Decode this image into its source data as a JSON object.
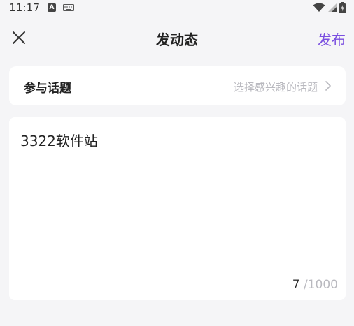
{
  "status_bar": {
    "time": "11:17",
    "notif_letter": "A"
  },
  "header": {
    "title": "发动态",
    "publish_label": "发布",
    "close_icon": "close-icon"
  },
  "topic": {
    "label": "参与话题",
    "hint": "选择感兴趣的话题"
  },
  "post": {
    "text": "3322软件站",
    "count": "7",
    "max": "/1000"
  },
  "colors": {
    "accent": "#7a4fe0",
    "background": "#f5f5f7",
    "card": "#ffffff",
    "hint": "#b9b9bf"
  }
}
